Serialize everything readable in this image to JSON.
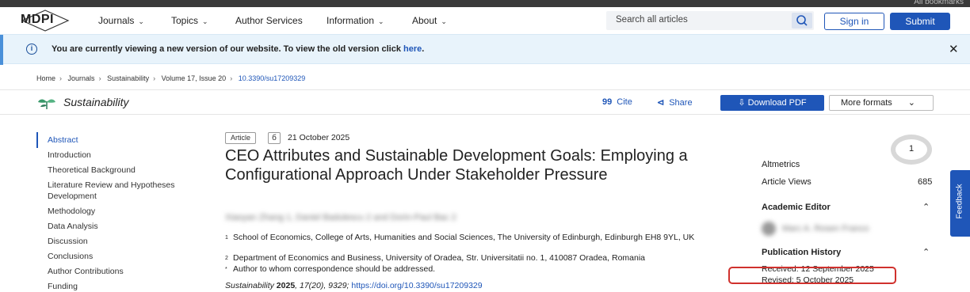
{
  "topbar": {
    "right_text": "All bookmarks"
  },
  "nav": {
    "logo": "MDPI",
    "items": [
      {
        "label": "Journals",
        "chevron": true
      },
      {
        "label": "Topics",
        "chevron": true
      },
      {
        "label": "Author Services",
        "chevron": false
      },
      {
        "label": "Information",
        "chevron": true
      },
      {
        "label": "About",
        "chevron": true
      }
    ],
    "search_placeholder": "Search all articles",
    "signin_label": "Sign in",
    "submit_label": "Submit"
  },
  "banner": {
    "message": "You are currently viewing a new version of our website. To view the old version click ",
    "link_text": "here",
    "suffix": "."
  },
  "breadcrumb": [
    "Home",
    "Journals",
    "Sustainability",
    "Volume 17, Issue 20",
    "10.3390/su17209329"
  ],
  "journal_bar": {
    "name": "Sustainability",
    "cite_label": "Cite",
    "share_label": "Share",
    "download_label": "Download PDF",
    "more_label": "More formats"
  },
  "toc": [
    "Abstract",
    "Introduction",
    "Theoretical Background",
    "Literature Review and Hypotheses Development",
    "Methodology",
    "Data Analysis",
    "Discussion",
    "Conclusions",
    "Author Contributions",
    "Funding"
  ],
  "article": {
    "type": "Article",
    "oa_icon": "open-access-icon",
    "date": "21 October 2025",
    "title": "CEO Attributes and Sustainable Development Goals: Employing a Configurational Approach Under Stakeholder Pressure",
    "authors_blurred": "Xiaoyan Zhang 1, Daniel Badulescu 2 and Dorin-Paul Bac 2",
    "affiliations": [
      {
        "mark": "1",
        "text": "School of Economics, College of Arts, Humanities and Social Sciences, The University of Edinburgh, Edinburgh EH8 9YL, UK"
      },
      {
        "mark": "2",
        "text": "Department of Economics and Business, University of Oradea, Str. Universitatii no. 1, 410087 Oradea, Romania"
      },
      {
        "mark": "*",
        "text": "Author to whom correspondence should be addressed."
      }
    ],
    "citation_journal": "Sustainability",
    "citation_year": "2025",
    "citation_rest": ", 17(20), 9329; ",
    "citation_doi": "https://doi.org/10.3390/su17209329"
  },
  "sidebar": {
    "altmetric_score": "1",
    "altmetrics_label": "Altmetrics",
    "views_label": "Article Views",
    "views_value": "685",
    "editor_heading": "Academic Editor",
    "editor_blurred": "Marc A. Rosen Franco",
    "history_heading": "Publication History",
    "received": "Received: 12 September 2025",
    "revised": "Revised: 5 October 2025"
  },
  "feedback_label": "Feedback"
}
